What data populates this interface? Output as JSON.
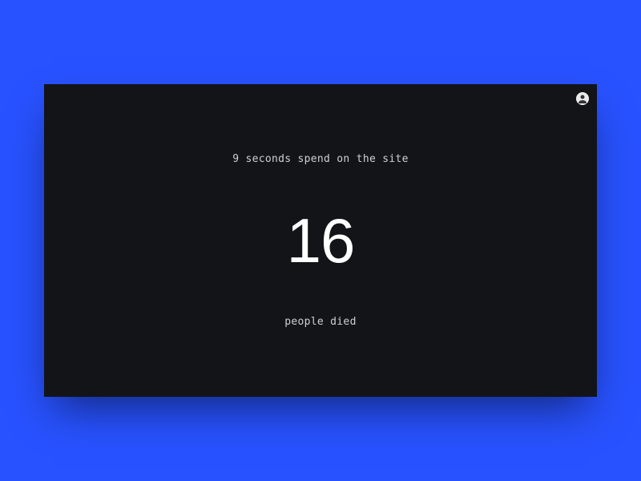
{
  "header": {
    "seconds_text": "9 seconds spend on the site"
  },
  "counter": {
    "value": "16"
  },
  "footer": {
    "label": "people died"
  }
}
